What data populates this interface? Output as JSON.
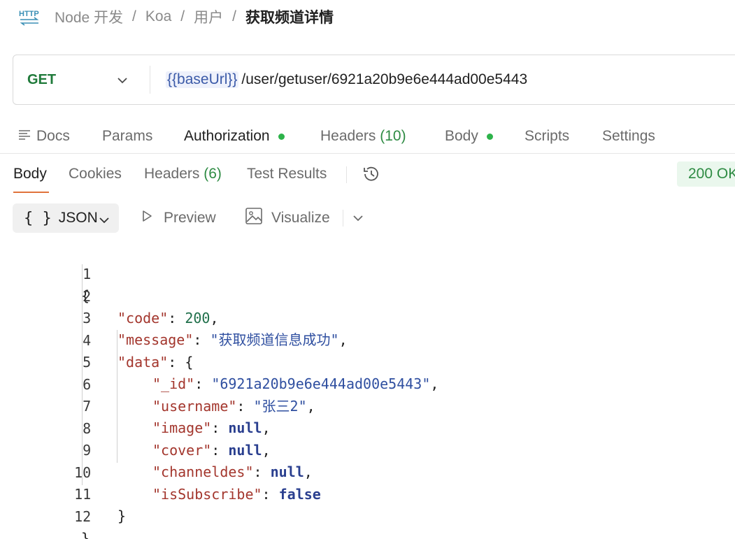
{
  "breadcrumb": {
    "icon": "http-icon",
    "items": [
      "Node 开发",
      "Koa",
      "用户"
    ],
    "current": "获取频道详情",
    "separator": "/"
  },
  "request": {
    "method": "GET",
    "url_variable": "{{baseUrl}}",
    "url_path": "/user/getuser/6921a20b9e6e444ad00e5443"
  },
  "request_tabs": {
    "docs": "Docs",
    "params": "Params",
    "authorization": "Authorization",
    "headers": "Headers",
    "headers_count": "(10)",
    "body": "Body",
    "scripts": "Scripts",
    "settings": "Settings"
  },
  "response_tabs": {
    "body": "Body",
    "cookies": "Cookies",
    "headers": "Headers",
    "headers_count": "(6)",
    "test_results": "Test Results",
    "status": "200 OK"
  },
  "format_bar": {
    "format_braces": "{ }",
    "format": "JSON",
    "preview": "Preview",
    "visualize": "Visualize"
  },
  "colors": {
    "method_get": "#1f7a3a",
    "dot_green": "#2db34a",
    "active_underline": "#e0733c",
    "json_key": "#a3362d",
    "json_string": "#2f4fa0",
    "json_number": "#1f6f4a",
    "json_keyword": "#2a3f8f"
  },
  "code": {
    "line_numbers": [
      "1",
      "2",
      "3",
      "4",
      "5",
      "6",
      "7",
      "8",
      "9",
      "10",
      "11",
      "12"
    ],
    "open_brace": "{",
    "close_brace": "}",
    "inner_close_brace": "}",
    "code_key": "\"code\"",
    "code_value": "200",
    "message_key": "\"message\"",
    "message_value": "\"获取频道信息成功\"",
    "data_key": "\"data\"",
    "id_key": "\"_id\"",
    "id_value": "\"6921a20b9e6e444ad00e5443\"",
    "username_key": "\"username\"",
    "username_value": "\"张三2\"",
    "image_key": "\"image\"",
    "image_value": "null",
    "cover_key": "\"cover\"",
    "cover_value": "null",
    "channeldes_key": "\"channeldes\"",
    "channeldes_value": "null",
    "isSubscribe_key": "\"isSubscribe\"",
    "isSubscribe_value": "false"
  }
}
